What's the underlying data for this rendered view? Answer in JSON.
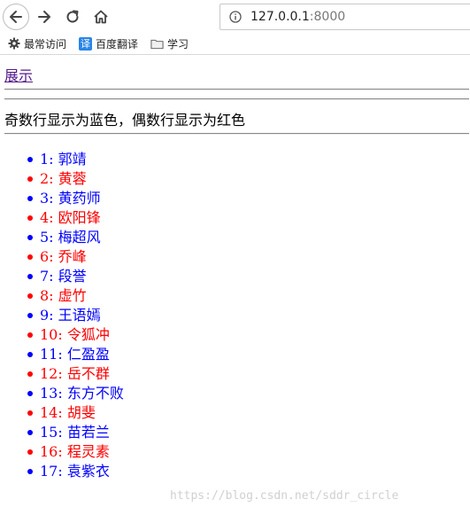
{
  "browser": {
    "url_host": "127.0.0.1",
    "url_port": ":8000",
    "bookmarks": [
      {
        "label": "最常访问",
        "icon": "gear-icon"
      },
      {
        "label": "百度翻译",
        "icon": "fanyi-icon",
        "glyph": "译"
      },
      {
        "label": "学习",
        "icon": "folder-icon"
      }
    ]
  },
  "page": {
    "link_label": "展示",
    "description": "奇数行显示为蓝色，偶数行显示为红色",
    "colors": {
      "odd": "#0000ff",
      "even": "#ff0000",
      "link": "#551a8b"
    },
    "items": [
      "1: 郭靖",
      "2: 黄蓉",
      "3: 黄药师",
      "4: 欧阳锋",
      "5: 梅超风",
      "6: 乔峰",
      "7: 段誉",
      "8: 虚竹",
      "9: 王语嫣",
      "10: 令狐冲",
      "11: 仁盈盈",
      "12: 岳不群",
      "13: 东方不败",
      "14: 胡斐",
      "15: 苗若兰",
      "16: 程灵素",
      "17: 袁紫衣"
    ]
  },
  "watermark": "https://blog.csdn.net/sddr_circle"
}
